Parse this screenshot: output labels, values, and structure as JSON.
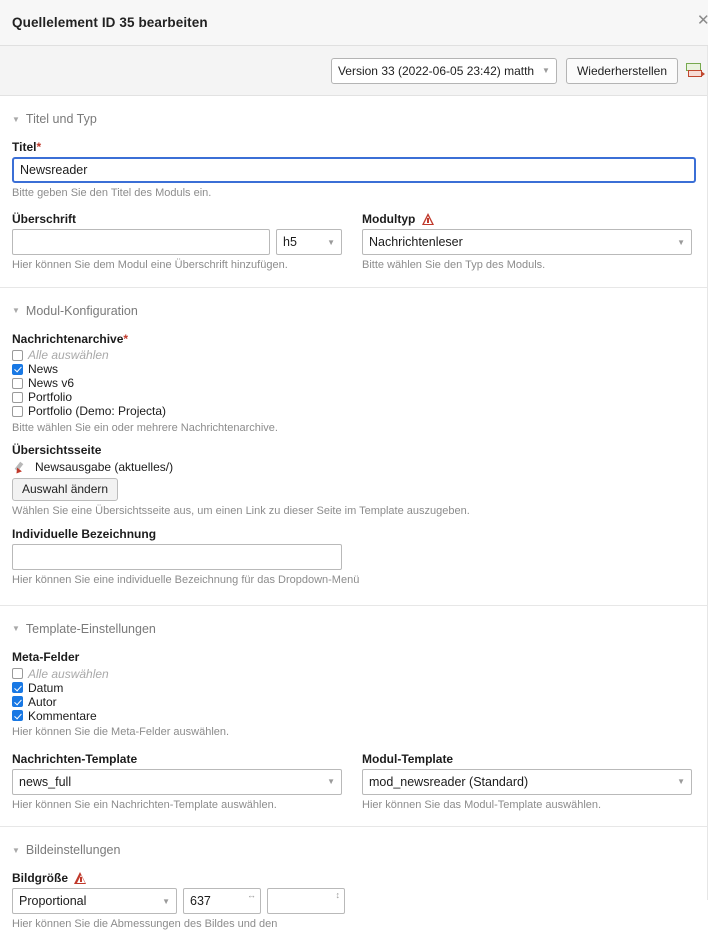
{
  "window": {
    "title": "Quellelement ID 35 bearbeiten",
    "close_icon": "close-icon"
  },
  "versionbar": {
    "version_selected": "Version 33 (2022-06-05 23:42) matth",
    "restore_label": "Wiederherstellen",
    "diff_icon": "compare-versions-icon"
  },
  "sections": [
    {
      "legend": "Titel und Typ",
      "fields": {
        "titel_label": "Titel",
        "titel_required": "*",
        "titel_value": "Newsreader",
        "titel_help": "Bitte geben Sie den Titel des Moduls ein.",
        "ueberschrift_label": "Überschrift",
        "ueberschrift_value": "",
        "ueberschrift_tag": "h5",
        "ueberschrift_help": "Hier können Sie dem Modul eine Überschrift hinzufügen.",
        "modultyp_label": "Modultyp",
        "modultyp_value": "Nachrichtenleser",
        "modultyp_help": "Bitte wählen Sie den Typ des Moduls."
      }
    },
    {
      "legend": "Modul-Konfiguration",
      "fields": {
        "archive_label": "Nachrichtenarchive",
        "archive_required": "*",
        "archive_items": [
          {
            "label": "Alle auswählen",
            "checked": false,
            "muted": true
          },
          {
            "label": "News",
            "checked": true,
            "muted": false
          },
          {
            "label": "News v6",
            "checked": false,
            "muted": false
          },
          {
            "label": "Portfolio",
            "checked": false,
            "muted": false
          },
          {
            "label": "Portfolio (Demo: Projecta)",
            "checked": false,
            "muted": false
          }
        ],
        "archive_help": "Bitte wählen Sie ein oder mehrere Nachrichtenarchive.",
        "uebersicht_label": "Übersichtsseite",
        "uebersicht_page": "Newsausgabe (aktuelles/)",
        "uebersicht_button": "Auswahl ändern",
        "uebersicht_help": "Wählen Sie eine Übersichtsseite aus, um einen Link zu dieser Seite im Template auszugeben.",
        "bezeichnung_label": "Individuelle Bezeichnung",
        "bezeichnung_value": "",
        "bezeichnung_help": "Hier können Sie eine individuelle Bezeichnung für das Dropdown-Menü"
      }
    },
    {
      "legend": "Template-Einstellungen",
      "fields": {
        "meta_label": "Meta-Felder",
        "meta_items": [
          {
            "label": "Alle auswählen",
            "checked": false,
            "muted": true
          },
          {
            "label": "Datum",
            "checked": true,
            "muted": false
          },
          {
            "label": "Autor",
            "checked": true,
            "muted": false
          },
          {
            "label": "Kommentare",
            "checked": true,
            "muted": false
          }
        ],
        "meta_help": "Hier können Sie die Meta-Felder auswählen.",
        "news_template_label": "Nachrichten-Template",
        "news_template_value": "news_full",
        "news_template_help": "Hier können Sie ein Nachrichten-Template auswählen.",
        "modul_template_label": "Modul-Template",
        "modul_template_value": "mod_newsreader (Standard)",
        "modul_template_help": "Hier können Sie das Modul-Template auswählen."
      }
    },
    {
      "legend": "Bildeinstellungen",
      "fields": {
        "bildgroesse_label": "Bildgröße",
        "bildgroesse_mode": "Proportional",
        "bildgroesse_width": "637",
        "bildgroesse_height": "",
        "bildgroesse_help": "Hier können Sie die Abmessungen des Bildes und den"
      }
    }
  ],
  "icons": {
    "collapse_triangle": "▼",
    "dropdown_caret": "▼",
    "warning": "warning-triangle-icon",
    "width_arrow": "↔",
    "height_arrow": "↕"
  },
  "colors": {
    "accent_focus": "#3b6fd6",
    "checkbox_checked": "#1878e4",
    "required_red": "#c0392b",
    "titlebar_bg": "#f7f7f7",
    "toolbar_bg": "#f4f4f4"
  }
}
